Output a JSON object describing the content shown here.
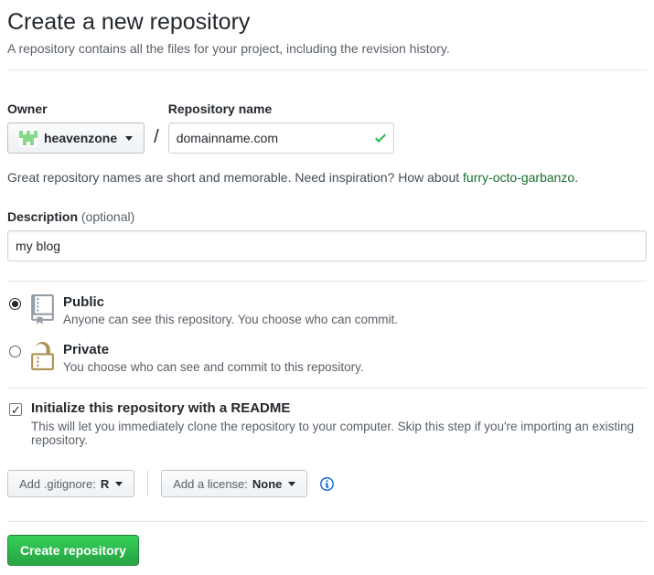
{
  "page": {
    "title": "Create a new repository",
    "subtitle": "A repository contains all the files for your project, including the revision history."
  },
  "owner": {
    "label": "Owner",
    "name": "heavenzone"
  },
  "separator": "/",
  "repo_name": {
    "label": "Repository name",
    "value": "domainname.com",
    "validation": "valid"
  },
  "hint": {
    "text_before": "Great repository names are short and memorable. Need inspiration? How about ",
    "suggestion": "furry-octo-garbanzo",
    "text_after": "."
  },
  "description": {
    "label": "Description",
    "optional": "(optional)",
    "value": "my blog"
  },
  "visibility": {
    "public": {
      "label": "Public",
      "note": "Anyone can see this repository. You choose who can commit.",
      "selected": true
    },
    "private": {
      "label": "Private",
      "note": "You choose who can see and commit to this repository.",
      "selected": false
    }
  },
  "readme": {
    "label": "Initialize this repository with a README",
    "note": "This will let you immediately clone the repository to your computer. Skip this step if you're importing an existing repository.",
    "checked": true
  },
  "options": {
    "gitignore_label": "Add .gitignore:",
    "gitignore_value": "R",
    "license_label": "Add a license:",
    "license_value": "None"
  },
  "submit": {
    "label": "Create repository"
  },
  "colors": {
    "button_green": "#28a745",
    "check_green": "#2cbe4e",
    "link_green": "#176f2c",
    "lock_gold": "#ac9150",
    "repo_icon_gray": "#959da5",
    "avatar_green": "#86d88a",
    "info_blue": "#0366d6"
  }
}
